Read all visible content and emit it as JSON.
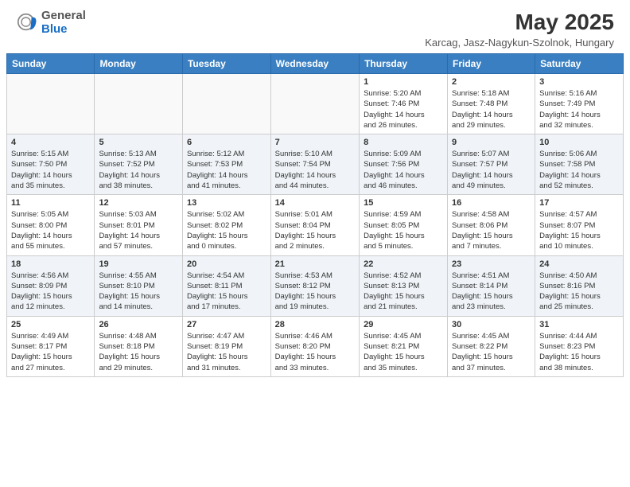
{
  "header": {
    "logo_general": "General",
    "logo_blue": "Blue",
    "month_year": "May 2025",
    "location": "Karcag, Jasz-Nagykun-Szolnok, Hungary"
  },
  "days_of_week": [
    "Sunday",
    "Monday",
    "Tuesday",
    "Wednesday",
    "Thursday",
    "Friday",
    "Saturday"
  ],
  "weeks": [
    [
      {
        "day": "",
        "info": ""
      },
      {
        "day": "",
        "info": ""
      },
      {
        "day": "",
        "info": ""
      },
      {
        "day": "",
        "info": ""
      },
      {
        "day": "1",
        "info": "Sunrise: 5:20 AM\nSunset: 7:46 PM\nDaylight: 14 hours\nand 26 minutes."
      },
      {
        "day": "2",
        "info": "Sunrise: 5:18 AM\nSunset: 7:48 PM\nDaylight: 14 hours\nand 29 minutes."
      },
      {
        "day": "3",
        "info": "Sunrise: 5:16 AM\nSunset: 7:49 PM\nDaylight: 14 hours\nand 32 minutes."
      }
    ],
    [
      {
        "day": "4",
        "info": "Sunrise: 5:15 AM\nSunset: 7:50 PM\nDaylight: 14 hours\nand 35 minutes."
      },
      {
        "day": "5",
        "info": "Sunrise: 5:13 AM\nSunset: 7:52 PM\nDaylight: 14 hours\nand 38 minutes."
      },
      {
        "day": "6",
        "info": "Sunrise: 5:12 AM\nSunset: 7:53 PM\nDaylight: 14 hours\nand 41 minutes."
      },
      {
        "day": "7",
        "info": "Sunrise: 5:10 AM\nSunset: 7:54 PM\nDaylight: 14 hours\nand 44 minutes."
      },
      {
        "day": "8",
        "info": "Sunrise: 5:09 AM\nSunset: 7:56 PM\nDaylight: 14 hours\nand 46 minutes."
      },
      {
        "day": "9",
        "info": "Sunrise: 5:07 AM\nSunset: 7:57 PM\nDaylight: 14 hours\nand 49 minutes."
      },
      {
        "day": "10",
        "info": "Sunrise: 5:06 AM\nSunset: 7:58 PM\nDaylight: 14 hours\nand 52 minutes."
      }
    ],
    [
      {
        "day": "11",
        "info": "Sunrise: 5:05 AM\nSunset: 8:00 PM\nDaylight: 14 hours\nand 55 minutes."
      },
      {
        "day": "12",
        "info": "Sunrise: 5:03 AM\nSunset: 8:01 PM\nDaylight: 14 hours\nand 57 minutes."
      },
      {
        "day": "13",
        "info": "Sunrise: 5:02 AM\nSunset: 8:02 PM\nDaylight: 15 hours\nand 0 minutes."
      },
      {
        "day": "14",
        "info": "Sunrise: 5:01 AM\nSunset: 8:04 PM\nDaylight: 15 hours\nand 2 minutes."
      },
      {
        "day": "15",
        "info": "Sunrise: 4:59 AM\nSunset: 8:05 PM\nDaylight: 15 hours\nand 5 minutes."
      },
      {
        "day": "16",
        "info": "Sunrise: 4:58 AM\nSunset: 8:06 PM\nDaylight: 15 hours\nand 7 minutes."
      },
      {
        "day": "17",
        "info": "Sunrise: 4:57 AM\nSunset: 8:07 PM\nDaylight: 15 hours\nand 10 minutes."
      }
    ],
    [
      {
        "day": "18",
        "info": "Sunrise: 4:56 AM\nSunset: 8:09 PM\nDaylight: 15 hours\nand 12 minutes."
      },
      {
        "day": "19",
        "info": "Sunrise: 4:55 AM\nSunset: 8:10 PM\nDaylight: 15 hours\nand 14 minutes."
      },
      {
        "day": "20",
        "info": "Sunrise: 4:54 AM\nSunset: 8:11 PM\nDaylight: 15 hours\nand 17 minutes."
      },
      {
        "day": "21",
        "info": "Sunrise: 4:53 AM\nSunset: 8:12 PM\nDaylight: 15 hours\nand 19 minutes."
      },
      {
        "day": "22",
        "info": "Sunrise: 4:52 AM\nSunset: 8:13 PM\nDaylight: 15 hours\nand 21 minutes."
      },
      {
        "day": "23",
        "info": "Sunrise: 4:51 AM\nSunset: 8:14 PM\nDaylight: 15 hours\nand 23 minutes."
      },
      {
        "day": "24",
        "info": "Sunrise: 4:50 AM\nSunset: 8:16 PM\nDaylight: 15 hours\nand 25 minutes."
      }
    ],
    [
      {
        "day": "25",
        "info": "Sunrise: 4:49 AM\nSunset: 8:17 PM\nDaylight: 15 hours\nand 27 minutes."
      },
      {
        "day": "26",
        "info": "Sunrise: 4:48 AM\nSunset: 8:18 PM\nDaylight: 15 hours\nand 29 minutes."
      },
      {
        "day": "27",
        "info": "Sunrise: 4:47 AM\nSunset: 8:19 PM\nDaylight: 15 hours\nand 31 minutes."
      },
      {
        "day": "28",
        "info": "Sunrise: 4:46 AM\nSunset: 8:20 PM\nDaylight: 15 hours\nand 33 minutes."
      },
      {
        "day": "29",
        "info": "Sunrise: 4:45 AM\nSunset: 8:21 PM\nDaylight: 15 hours\nand 35 minutes."
      },
      {
        "day": "30",
        "info": "Sunrise: 4:45 AM\nSunset: 8:22 PM\nDaylight: 15 hours\nand 37 minutes."
      },
      {
        "day": "31",
        "info": "Sunrise: 4:44 AM\nSunset: 8:23 PM\nDaylight: 15 hours\nand 38 minutes."
      }
    ]
  ]
}
